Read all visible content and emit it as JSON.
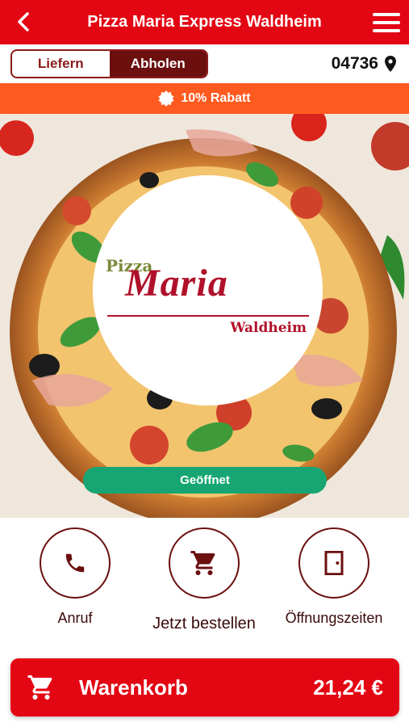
{
  "header": {
    "title": "Pizza Maria Express Waldheim",
    "back_icon": "chevron-left-icon",
    "menu_icon": "hamburger-menu-icon",
    "background": "#e30613"
  },
  "mode_toggle": {
    "options": [
      {
        "label": "Liefern",
        "active": false
      },
      {
        "label": "Abholen",
        "active": true
      }
    ],
    "accent": "#6b0f0f"
  },
  "location": {
    "postal_code": "04736",
    "icon": "map-pin-icon"
  },
  "promo": {
    "text": "10% Rabatt",
    "icon": "badge-percent-icon",
    "background": "#ff5a1f"
  },
  "restaurant_logo": {
    "line1": "Pizza",
    "line2": "Maria",
    "line3": "Waldheim"
  },
  "status": {
    "label": "Geöffnet",
    "color": "#17a673"
  },
  "actions": [
    {
      "label": "Anruf",
      "icon": "phone-icon"
    },
    {
      "label": "Jetzt bestellen",
      "icon": "shopping-cart-icon"
    },
    {
      "label": "Öffnungszeiten",
      "icon": "door-icon"
    }
  ],
  "cart": {
    "label": "Warenkorb",
    "total": "21,24 €",
    "icon": "shopping-cart-icon",
    "background": "#e30613"
  }
}
